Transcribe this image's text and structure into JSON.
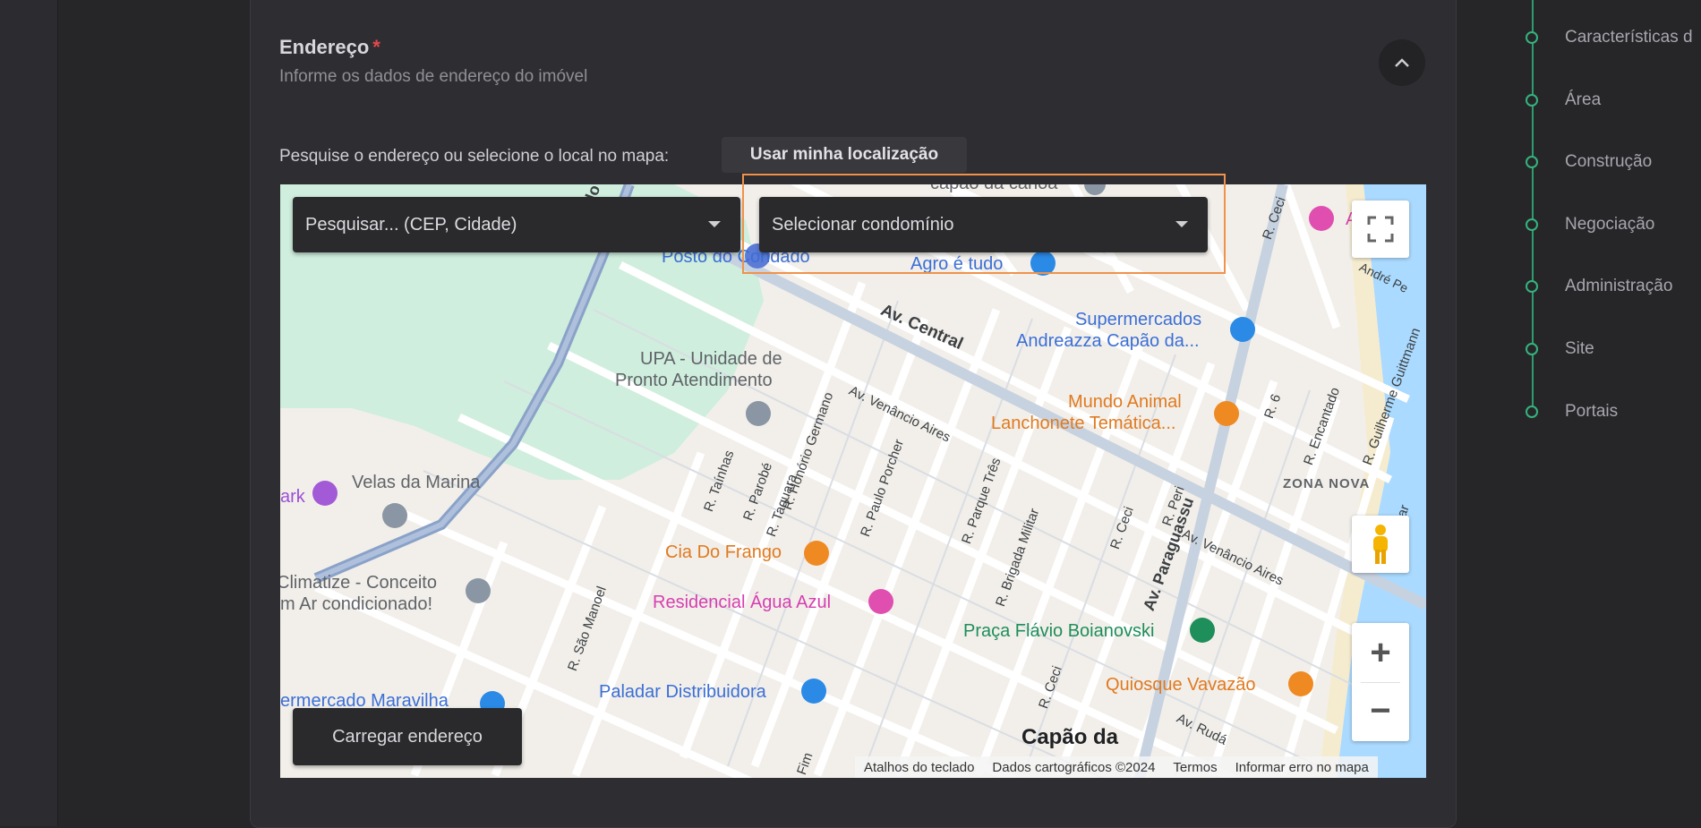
{
  "address_section": {
    "title": "Endereço",
    "required_mark": "*",
    "subtitle": "Informe os dados de endereço do imóvel",
    "collapse_icon": "chevron-up-icon"
  },
  "search": {
    "label": "Pesquise o endereço ou selecione o local no mapa:",
    "use_location_button": "Usar minha localização",
    "search_placeholder": "Pesquisar... (CEP, Cidade)",
    "condo_placeholder": "Selecionar condomínio",
    "load_address_button": "Carregar endereço"
  },
  "map": {
    "streets": [
      "Estr. do Mar",
      "Av. Central",
      "Av. Venâncio Aires",
      "Av. Venâncio Aires",
      "R. Taínhas",
      "R. Parobé",
      "R. Taquara",
      "R. Honório Germano",
      "R. Paulo Porcher",
      "R. Parque Três",
      "R. Brigada Militar",
      "R. Ceci",
      "R. Peri",
      "Av. Paraguassu",
      "R. 6",
      "R. Encantado",
      "R. Guilherme Guittmann",
      "R. Ceci",
      "R. São Manoel",
      "Av. Rudá",
      "R. Ceci",
      "André Pe",
      "Mar",
      "Fim"
    ],
    "places": [
      {
        "name": "capão da canoa",
        "color": "#5f6368"
      },
      {
        "name": "Posto do Condado",
        "color": "#3b6fd6"
      },
      {
        "name": "Agro é tudo",
        "color": "#3b6fd6"
      },
      {
        "name": "Supermercados",
        "color": "#3b6fd6"
      },
      {
        "name": "Andreazza Capão da...",
        "color": "#3b6fd6"
      },
      {
        "name": "UPA - Unidade de",
        "color": "#5f6368"
      },
      {
        "name": "Pronto Atendimento",
        "color": "#5f6368"
      },
      {
        "name": "Mundo Animal",
        "color": "#e07a1f"
      },
      {
        "name": "Lanchonete Temática...",
        "color": "#e07a1f"
      },
      {
        "name": "Velas da Marina",
        "color": "#5f6368"
      },
      {
        "name": "ark",
        "color": "#9c4fd6"
      },
      {
        "name": "ZONA NOVA",
        "color": "#5f6368"
      },
      {
        "name": "Cia Do Frango",
        "color": "#e07a1f"
      },
      {
        "name": "Climatize - Conceito",
        "color": "#5f6368"
      },
      {
        "name": "m Ar condicionado!",
        "color": "#5f6368"
      },
      {
        "name": "Residencial Água Azul",
        "color": "#d63fb0"
      },
      {
        "name": "Praça Flávio Boianovski",
        "color": "#1e8e5a"
      },
      {
        "name": "Quiosque Vavazão",
        "color": "#e07a1f"
      },
      {
        "name": "ermercado Maravilha",
        "color": "#3b6fd6"
      },
      {
        "name": "Paladar Distribuidora",
        "color": "#3b6fd6"
      },
      {
        "name": "Capão da",
        "color": "#202124"
      },
      {
        "name": "A",
        "color": "#d63fb0"
      }
    ],
    "controls": {
      "fullscreen_icon": "fullscreen-icon",
      "pegman_icon": "street-view-pegman-icon",
      "zoom_in": "+",
      "zoom_out": "−"
    },
    "attribution": [
      "Atalhos do teclado",
      "Dados cartográficos ©2024",
      "Termos",
      "Informar erro no mapa"
    ]
  },
  "stepper": {
    "steps": [
      "Características d",
      "Área",
      "Construção",
      "Negociação",
      "Administração",
      "Site",
      "Portais"
    ]
  },
  "colors": {
    "accent_green": "#35b37e",
    "highlight_orange": "#f0924a",
    "required_red": "#e5484d"
  }
}
